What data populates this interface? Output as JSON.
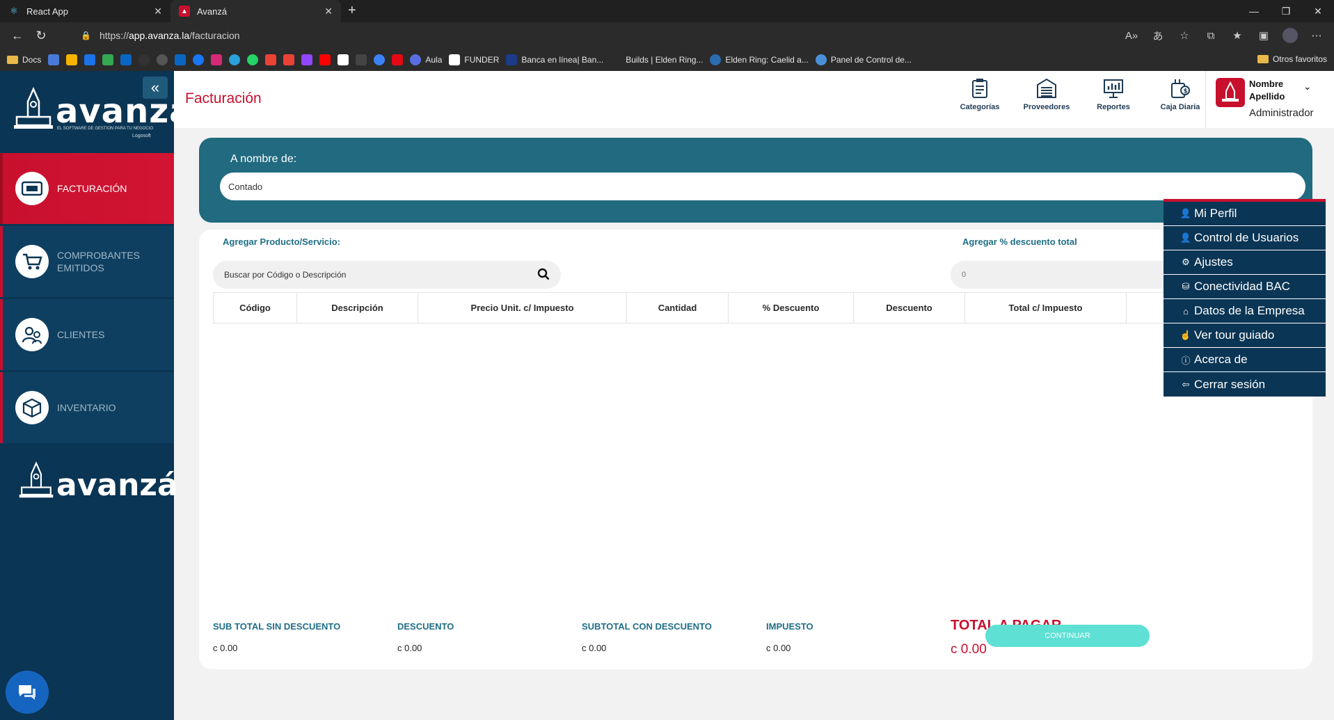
{
  "browser": {
    "tabs": [
      {
        "title": "React App",
        "icon": "react-icon"
      },
      {
        "title": "Avanzá",
        "icon": "avanza-icon"
      }
    ],
    "url_scheme": "https://",
    "url_host": "app.avanza.la",
    "url_path": "/facturacion",
    "bookmarks": [
      {
        "label": "Docs"
      },
      {
        "label": "Aula"
      },
      {
        "label": "FUNDER"
      },
      {
        "label": "Banca en línea| Ban..."
      },
      {
        "label": "Builds | Elden Ring..."
      },
      {
        "label": "Elden Ring: Caelid a..."
      },
      {
        "label": "Panel de Control de..."
      }
    ],
    "other_favorites": "Otros favoritos"
  },
  "sidebar": {
    "logo_text": "avanza",
    "logo_tagline": "EL SOFTWARE DE GESTION PARA TU NEGOCIO",
    "logo_brand": "Logosoft",
    "items": [
      {
        "label": "FACTURACIÓN",
        "icon": "invoice-icon",
        "active": true
      },
      {
        "label": "COMPROBANTES EMITIDOS",
        "icon": "cart-icon",
        "active": false
      },
      {
        "label": "CLIENTES",
        "icon": "clients-icon",
        "active": false
      },
      {
        "label": "INVENTARIO",
        "icon": "box-icon",
        "active": false
      }
    ],
    "bottom_logo_text": "avanzá"
  },
  "header": {
    "title": "Facturación",
    "shortcuts": [
      {
        "label": "Categorías",
        "icon": "clipboard-icon"
      },
      {
        "label": "Proveedores",
        "icon": "warehouse-icon"
      },
      {
        "label": "Reportes",
        "icon": "report-icon"
      },
      {
        "label": "Caja Diaria",
        "icon": "cashbox-icon"
      }
    ],
    "user": {
      "name": "Nombre Apellido",
      "role": "Administrador"
    }
  },
  "invoice": {
    "name_label": "A nombre de:",
    "name_value": "Contado",
    "add_product_label": "Agregar Producto/Servicio:",
    "search_placeholder": "Buscar por Código o Descripción",
    "discount_label": "Agregar % descuento total",
    "discount_value": "0",
    "columns": [
      "Código",
      "Descripción",
      "Precio Unit. c/ Impuesto",
      "Cantidad",
      "% Descuento",
      "Descuento",
      "Total c/ Impuesto"
    ],
    "totals": {
      "subtotal_sin_label": "SUB TOTAL SIN DESCUENTO",
      "subtotal_sin_value": "c 0.00",
      "descuento_label": "DESCUENTO",
      "descuento_value": "c 0.00",
      "subtotal_con_label": "SUBTOTAL CON DESCUENTO",
      "subtotal_con_value": "c 0.00",
      "impuesto_label": "IMPUESTO",
      "impuesto_value": "c 0.00",
      "total_label": "TOTAL A PAGAR",
      "total_value": "c 0.00"
    },
    "continue_label": "CONTINUAR"
  },
  "user_menu": [
    {
      "label": "Mi Perfil",
      "icon": "user-icon"
    },
    {
      "label": "Control de Usuarios",
      "icon": "users-icon"
    },
    {
      "label": "Ajustes",
      "icon": "gear-icon"
    },
    {
      "label": "Conectividad BAC",
      "icon": "coins-icon"
    },
    {
      "label": "Datos de la Empresa",
      "icon": "home-icon"
    },
    {
      "label": "Ver tour guiado",
      "icon": "tour-icon"
    },
    {
      "label": "Acerca de",
      "icon": "info-icon"
    },
    {
      "label": "Cerrar sesión",
      "icon": "logout-icon"
    }
  ],
  "colors": {
    "primary": "#0b3554",
    "accent": "#c8102e",
    "teal": "#216a80",
    "button": "#5ee0d4"
  }
}
